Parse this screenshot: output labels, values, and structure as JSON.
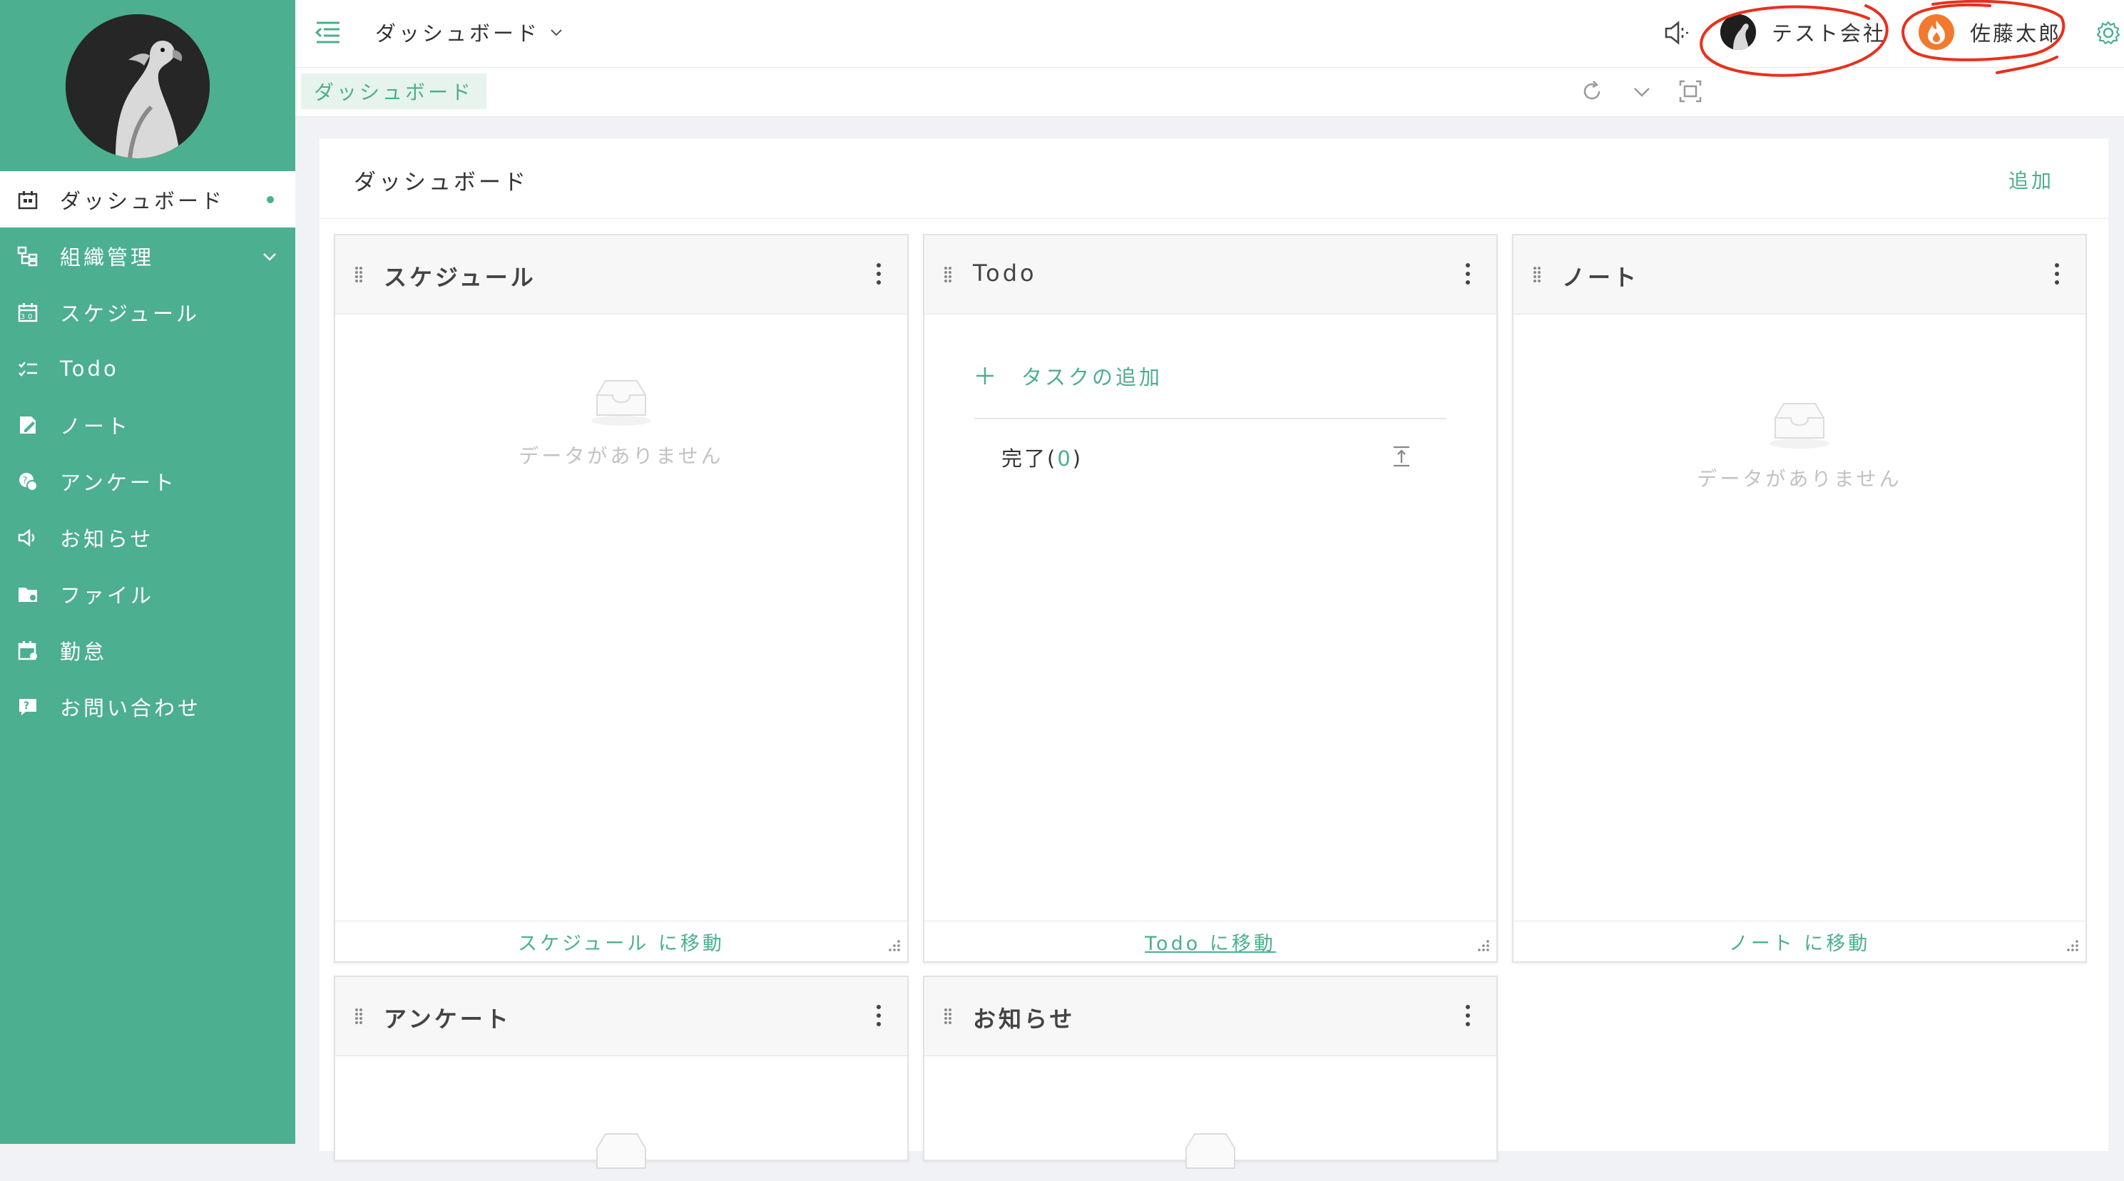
{
  "sidebar": {
    "items": [
      {
        "label": "ダッシュボード",
        "icon": "dashboard-icon",
        "active": true
      },
      {
        "label": "組織管理",
        "icon": "org-icon",
        "has_children": true
      },
      {
        "label": "スケジュール",
        "icon": "calendar-icon"
      },
      {
        "label": "Todo",
        "icon": "checklist-icon"
      },
      {
        "label": "ノート",
        "icon": "note-icon"
      },
      {
        "label": "アンケート",
        "icon": "survey-icon"
      },
      {
        "label": "お知らせ",
        "icon": "speaker-icon"
      },
      {
        "label": "ファイル",
        "icon": "folder-icon"
      },
      {
        "label": "勤怠",
        "icon": "attendance-icon"
      },
      {
        "label": "お問い合わせ",
        "icon": "inquiry-icon"
      }
    ]
  },
  "header": {
    "breadcrumb": "ダッシュボード",
    "company": "テスト会社",
    "user": "佐藤太郎"
  },
  "tabs": [
    {
      "label": "ダッシュボード",
      "active": true
    }
  ],
  "main": {
    "title": "ダッシュボード",
    "add_label": "追加"
  },
  "widgets": {
    "schedule": {
      "title": "スケジュール",
      "empty": "データがありません",
      "footer": "スケジュール に移動"
    },
    "todo": {
      "title": "Todo",
      "add_task": "タスクの追加",
      "done_prefix": "完了(",
      "done_count": "0",
      "done_suffix": ")",
      "footer": "Todo に移動"
    },
    "note": {
      "title": "ノート",
      "empty": "データがありません",
      "footer": "ノート に移動"
    },
    "survey": {
      "title": "アンケート"
    },
    "notice": {
      "title": "お知らせ"
    }
  },
  "colors": {
    "accent": "#4caf8f",
    "annotation": "#e8301c"
  }
}
